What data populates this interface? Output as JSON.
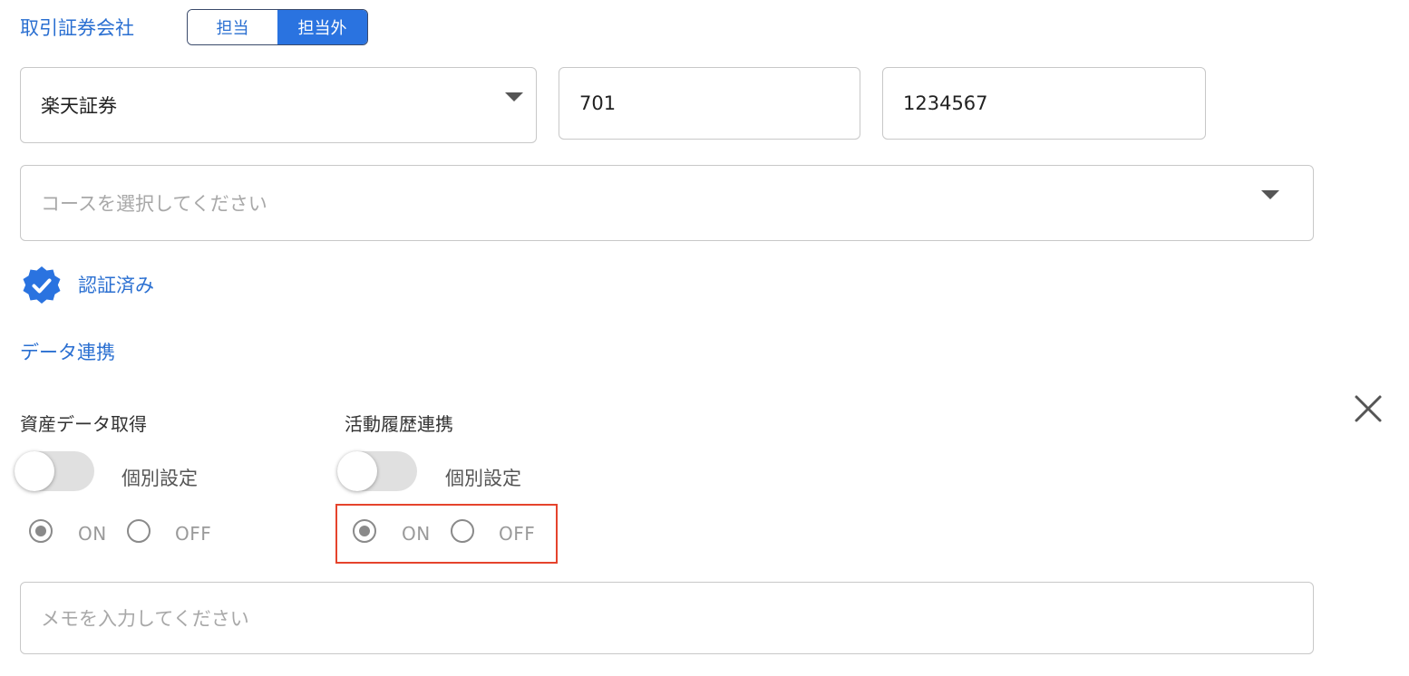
{
  "broker_section": {
    "label": "取引証券会社",
    "segments": [
      {
        "label": "担当",
        "active": false
      },
      {
        "label": "担当外",
        "active": true
      }
    ]
  },
  "broker_select": {
    "value": "楽天証券"
  },
  "branch_code": {
    "value": "701"
  },
  "account_number": {
    "value": "1234567"
  },
  "course_select": {
    "placeholder": "コースを選択してください"
  },
  "verified": {
    "label": "認証済み",
    "icon": "verified-badge-icon",
    "color": "#2a73e0"
  },
  "data_link": {
    "heading": "データ連携",
    "asset_data": {
      "title": "資産データ取得",
      "toggle_label": "個別設定",
      "toggle_on": false,
      "options": [
        "ON",
        "OFF"
      ],
      "selected": "ON"
    },
    "activity_history": {
      "title": "活動履歴連携",
      "toggle_label": "個別設定",
      "toggle_on": false,
      "options": [
        "ON",
        "OFF"
      ],
      "selected": "ON"
    }
  },
  "memo": {
    "placeholder": "メモを入力してください"
  },
  "close": {
    "icon": "close-icon"
  },
  "colors": {
    "accent": "#2a73e0",
    "link_text": "#2a6fd1",
    "highlight": "#e5432c"
  }
}
